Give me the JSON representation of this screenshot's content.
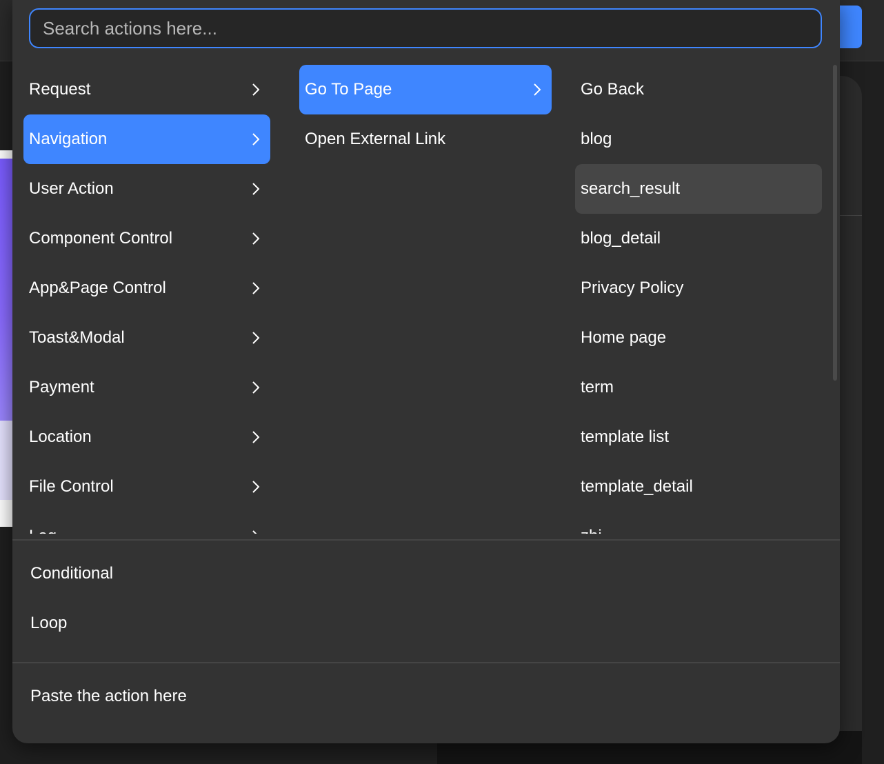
{
  "search": {
    "placeholder": "Search actions here..."
  },
  "categories": [
    {
      "label": "Request"
    },
    {
      "label": "Navigation"
    },
    {
      "label": "User Action"
    },
    {
      "label": "Component Control"
    },
    {
      "label": "App&Page Control"
    },
    {
      "label": "Toast&Modal"
    },
    {
      "label": "Payment"
    },
    {
      "label": "Location"
    },
    {
      "label": "File Control"
    },
    {
      "label": "Log"
    }
  ],
  "navigation_actions": [
    {
      "label": "Go To Page"
    },
    {
      "label": "Open External Link"
    }
  ],
  "pages": [
    {
      "label": "Go Back"
    },
    {
      "label": "blog"
    },
    {
      "label": "search_result"
    },
    {
      "label": "blog_detail"
    },
    {
      "label": "Privacy Policy"
    },
    {
      "label": "Home page"
    },
    {
      "label": "term"
    },
    {
      "label": "template list"
    },
    {
      "label": "template_detail"
    },
    {
      "label": "zhi"
    }
  ],
  "extras": {
    "conditional": "Conditional",
    "loop": "Loop",
    "paste": "Paste the action here"
  },
  "state": {
    "selected_category": "Navigation",
    "selected_action": "Go To Page",
    "hovered_page": "search_result"
  },
  "colors": {
    "accent": "#3f86ff",
    "panel": "#333333",
    "hover": "#464646"
  }
}
